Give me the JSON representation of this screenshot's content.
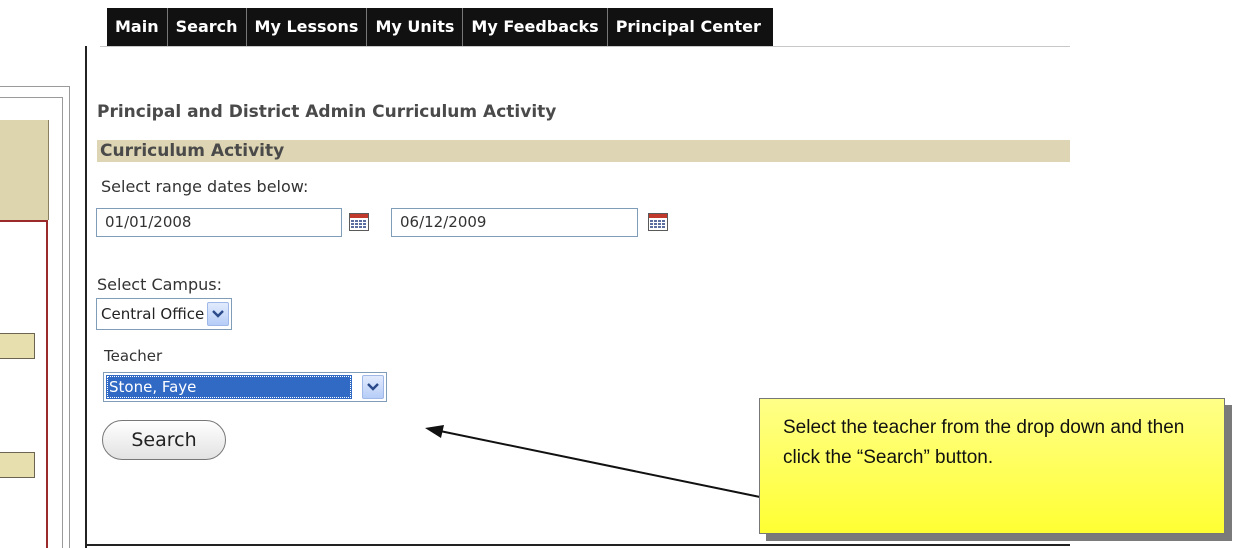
{
  "tabs": [
    "Main",
    "Search",
    "My Lessons",
    "My Units",
    "My Feedbacks",
    "Principal Center"
  ],
  "page_title": "Principal and District Admin Curriculum Activity",
  "section_title": "Curriculum Activity",
  "range_label": "Select range dates below:",
  "start_date": "01/01/2008",
  "end_date": "06/12/2009",
  "campus_label": "Select Campus:",
  "campus_value": "Central Office",
  "teacher_label": "Teacher",
  "teacher_value": "Stone, Faye",
  "search_button": "Search",
  "callout_text": "Select the teacher from the drop down and then click the “Search” button.",
  "colors": {
    "tab_bg": "#111111",
    "section_bar": "#ddd5b3",
    "callout": "#ffff55",
    "selection": "#316ac5"
  },
  "icons": [
    "calendar-icon",
    "calendar-icon",
    "chevron-down-icon",
    "chevron-down-icon"
  ]
}
